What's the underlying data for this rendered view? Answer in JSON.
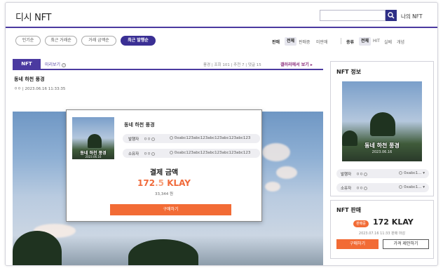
{
  "header": {
    "site_title": "디시 NFT",
    "search_placeholder": "",
    "my_nft": "나의 NFT"
  },
  "sort_options": [
    {
      "label": "인기순",
      "active": false
    },
    {
      "label": "최근 거래순",
      "active": false
    },
    {
      "label": "거래 금액순",
      "active": false
    },
    {
      "label": "최근 발행순",
      "active": true
    }
  ],
  "filters": {
    "sale_label": "판매",
    "sale_options": [
      "전체",
      "판매중",
      "미판매"
    ],
    "type_label": "종류",
    "type_options": [
      "전체",
      "HIT",
      "실베",
      "개념"
    ]
  },
  "tab": {
    "nft": "NFT",
    "preview": "미리보기"
  },
  "stats": {
    "text": "풍경  |  조회 101  |  추천 7  |  댓글 15",
    "gallery_link": "갤러리에서 보기 ▸"
  },
  "post": {
    "title": "동네 하천 풍경",
    "meta": "ㅇㅇ  |  2023.06.16 11:33:35"
  },
  "modal": {
    "title": "동네 하천 풍경",
    "issuer_label": "발행자",
    "owner_label": "소유자",
    "user_name": "ㅇㅇ",
    "address": "0xabc123abc123abc123abc123abc123",
    "pay_title": "결제 금액",
    "amount_int": "172",
    "amount_dec": ".5",
    "amount_unit": " KLAY",
    "krw": "33,344 원",
    "buy_label": "구매하기"
  },
  "thumb": {
    "title": "동네 하천 풍경",
    "date": "2023.06.16"
  },
  "nft_info": {
    "title": "NFT 정보",
    "issuer_label": "발행자",
    "owner_label": "소유자",
    "user_name": "ㅇㅇ",
    "short_address": "0xabc1...  ▾"
  },
  "nft_sale": {
    "title": "NFT 판매",
    "badge": "판매중",
    "price": "172 KLAY",
    "date": "2023.07.16 11:33 판매 마감",
    "buy_label": "구매하기",
    "offer_label": "가격 제안하기"
  },
  "colors": {
    "brand": "#4b3aa0",
    "accent": "#f26b35"
  }
}
